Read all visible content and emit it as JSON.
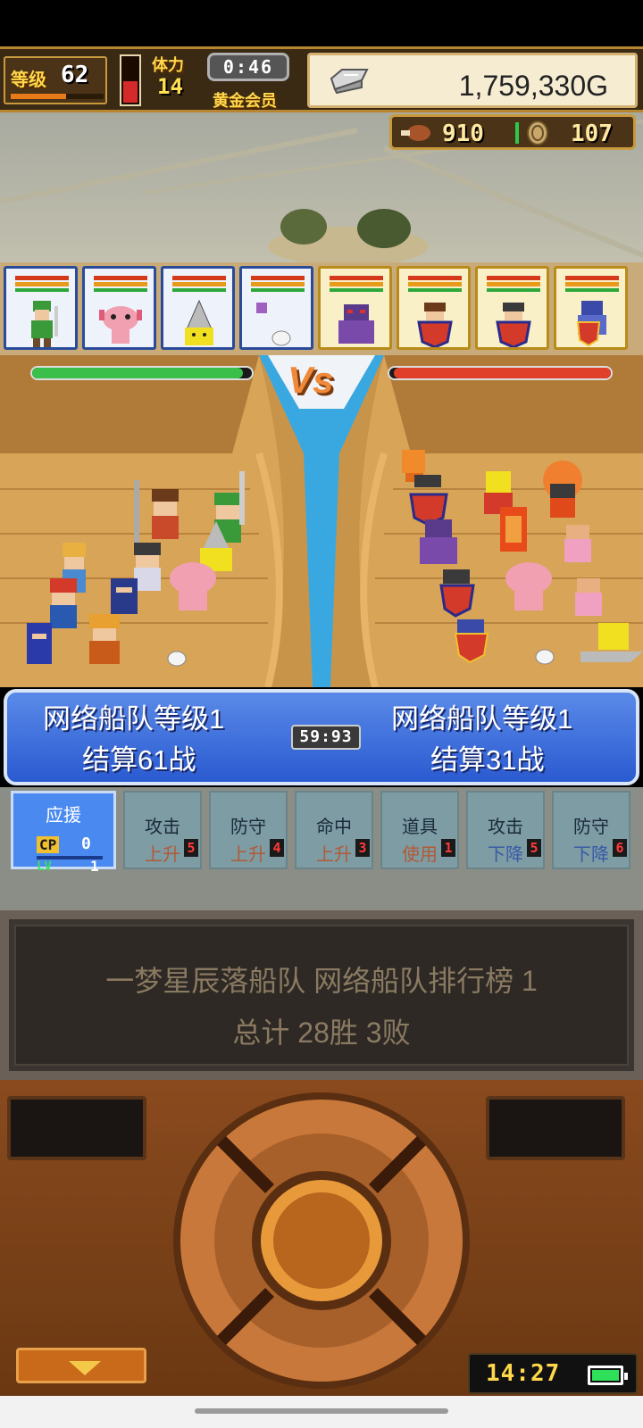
{
  "hud": {
    "level_label": "等级",
    "level_value": "62",
    "stamina_label": "体力",
    "stamina_value": "14",
    "timer": "0:46",
    "member_label": "黄金会员",
    "gold": "1,759,330G",
    "meat": "910",
    "coins": "107",
    "stamina_fill_percent": 45,
    "exp_fill_percent": 60
  },
  "battle": {
    "vs": "Vs",
    "ally_hp_percent": 96,
    "enemy_hp_percent": 98,
    "ally_team": "网络船队等级1",
    "ally_result": "结算61战",
    "enemy_team": "网络船队等级1",
    "enemy_result": "结算31战",
    "battle_timer": "59:93"
  },
  "commands": {
    "support_label": "应援",
    "cp_label": "CP",
    "cp_value": "0",
    "lv_label": "LV",
    "lv_value": "1",
    "buttons": [
      {
        "line1": "攻击",
        "line2": "上升",
        "count": "5"
      },
      {
        "line1": "防守",
        "line2": "上升",
        "count": "4"
      },
      {
        "line1": "命中",
        "line2": "上升",
        "count": "3"
      },
      {
        "line1": "道具",
        "line2": "使用",
        "count": "1"
      },
      {
        "line1": "攻击",
        "line2": "下降",
        "count": "5"
      },
      {
        "line1": "防守",
        "line2": "下降",
        "count": "6"
      }
    ]
  },
  "info": {
    "line1": "一梦星辰落船队  网络船队排行榜  1",
    "line2": "总计 28胜 3败"
  },
  "status": {
    "clock": "14:27"
  },
  "colors": {
    "ally_blue": "#2a5ad0",
    "enemy_gold": "#b88a1a",
    "gold_text": "#ffd84a"
  },
  "icons": [
    "silver-ingot-icon",
    "meat-icon",
    "coin-icon",
    "down-arrow-icon",
    "battery-icon"
  ]
}
